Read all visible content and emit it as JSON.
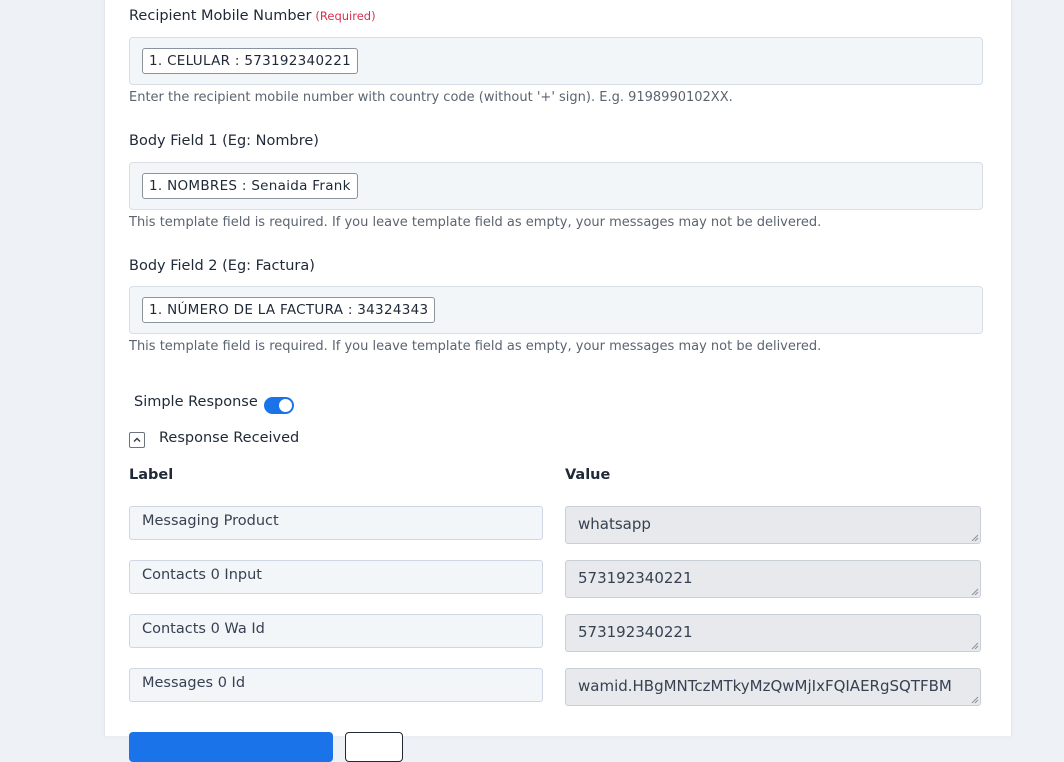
{
  "recipient": {
    "label": "Recipient Mobile Number",
    "required": "(Required)",
    "pill": "1. CELULAR : 573192340221",
    "help": "Enter the recipient mobile number with country code (without '+' sign). E.g. 9198990102XX."
  },
  "body1": {
    "label": "Body Field 1 (Eg: Nombre)",
    "pill": "1. NOMBRES : Senaida Frank",
    "help": "This template field is required. If you leave template field as empty, your messages may not be delivered."
  },
  "body2": {
    "label": "Body Field 2 (Eg: Factura)",
    "pill": "1. NÚMERO DE LA FACTURA : 34324343",
    "help": "This template field is required. If you leave template field as empty, your messages may not be delivered."
  },
  "simple_response": {
    "label": "Simple Response",
    "enabled": true
  },
  "response": {
    "title": "Response Received",
    "label_header": "Label",
    "value_header": "Value",
    "rows": [
      {
        "label": "Messaging Product",
        "value": "whatsapp"
      },
      {
        "label": "Contacts 0 Input",
        "value": "573192340221"
      },
      {
        "label": "Contacts 0 Wa Id",
        "value": "573192340221"
      },
      {
        "label": "Messages 0 Id",
        "value": "wamid.HBgMNTczMTkyMzQwMjIxFQIAERgSQTFBM"
      }
    ]
  },
  "colors": {
    "accent": "#1a73e8",
    "required": "#d9304f"
  },
  "icons": {
    "collapse": "chevron-up-icon",
    "resize": "resize-grip-icon"
  }
}
